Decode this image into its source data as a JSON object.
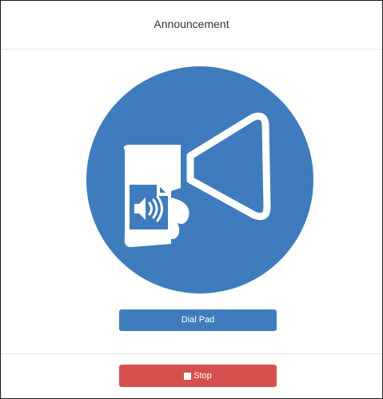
{
  "dialog": {
    "title": "Announcement"
  },
  "hero": {
    "icon": "megaphone-icon",
    "badge_icon": "audio-file-icon",
    "circle_color": "#3f7cbd",
    "glyph_color": "#ffffff"
  },
  "actions": {
    "dial_pad_label": "Dial Pad",
    "dial_pad_color": "#3f7cbd"
  },
  "footer": {
    "stop_label": "Stop",
    "stop_icon": "stop-icon",
    "stop_color": "#d6514d"
  }
}
